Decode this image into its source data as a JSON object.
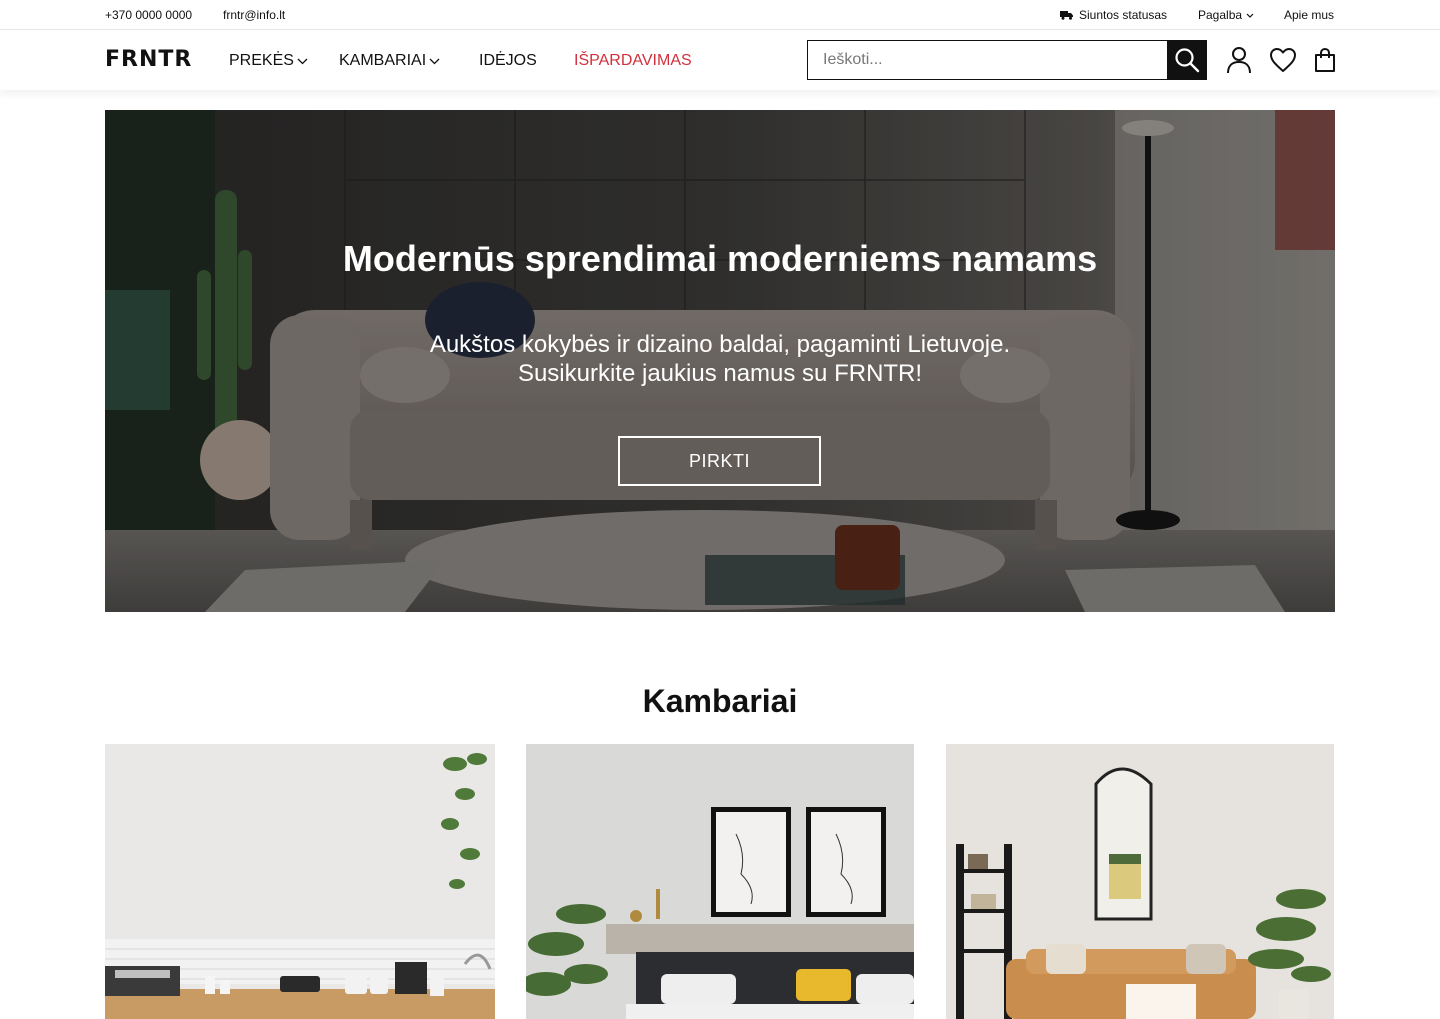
{
  "topbar": {
    "phone": "+370 0000 0000",
    "email": "frntr@info.lt",
    "shipping_status": "Siuntos statusas",
    "help": "Pagalba",
    "about": "Apie mus"
  },
  "header": {
    "logo": "FRNTR",
    "nav": {
      "products": "PREKĖS",
      "rooms": "KAMBARIAI",
      "ideas": "IDĖJOS",
      "sale": "IŠPARDAVIMAS"
    },
    "search_placeholder": "Ieškoti...",
    "icons": [
      "search-icon",
      "user-icon",
      "heart-icon",
      "shopping-bag-icon",
      "truck-icon",
      "chevron-down-icon"
    ],
    "sale_color": "#d0313c"
  },
  "hero": {
    "title": "Modernūs sprendimai moderniems namams",
    "subtitle_line1": "Aukštos kokybės ir dizaino baldai, pagaminti Lietuvoje.",
    "subtitle_line2": "Susikurkite jaukius namus su FRNTR!",
    "cta": "PIRKTI"
  },
  "rooms_section": {
    "title": "Kambariai",
    "cards": [
      "kitchen",
      "bedroom",
      "living-room"
    ]
  }
}
